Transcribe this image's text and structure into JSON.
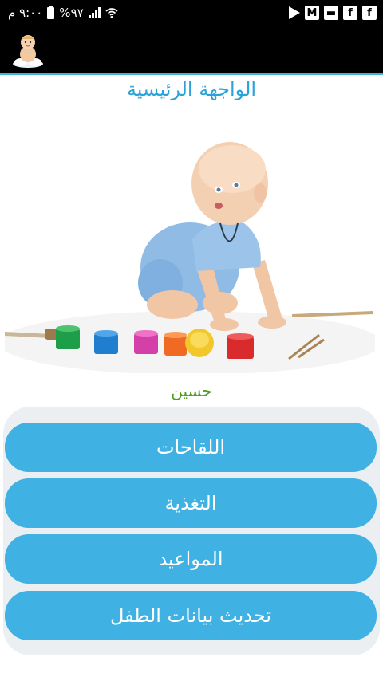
{
  "status_bar": {
    "time": "٩:٠٠ م",
    "battery": "%٩٧",
    "icons": [
      "play-store-icon",
      "gmail-icon",
      "notification-icon",
      "facebook-icon",
      "facebook-icon"
    ]
  },
  "app_bar": {
    "logo": "baby-logo-icon"
  },
  "page": {
    "title": "الواجهة الرئيسية",
    "child_name": "حسين"
  },
  "menu": {
    "vaccinations": "اللقاحات",
    "nutrition": "التغذية",
    "appointments": "المواعيد",
    "update_child_data": "تحديث بيانات الطفل"
  },
  "colors": {
    "accent": "#3fb1e3",
    "title": "#2ba3d8",
    "name": "#4f9d1f",
    "panel": "#eceff2"
  }
}
